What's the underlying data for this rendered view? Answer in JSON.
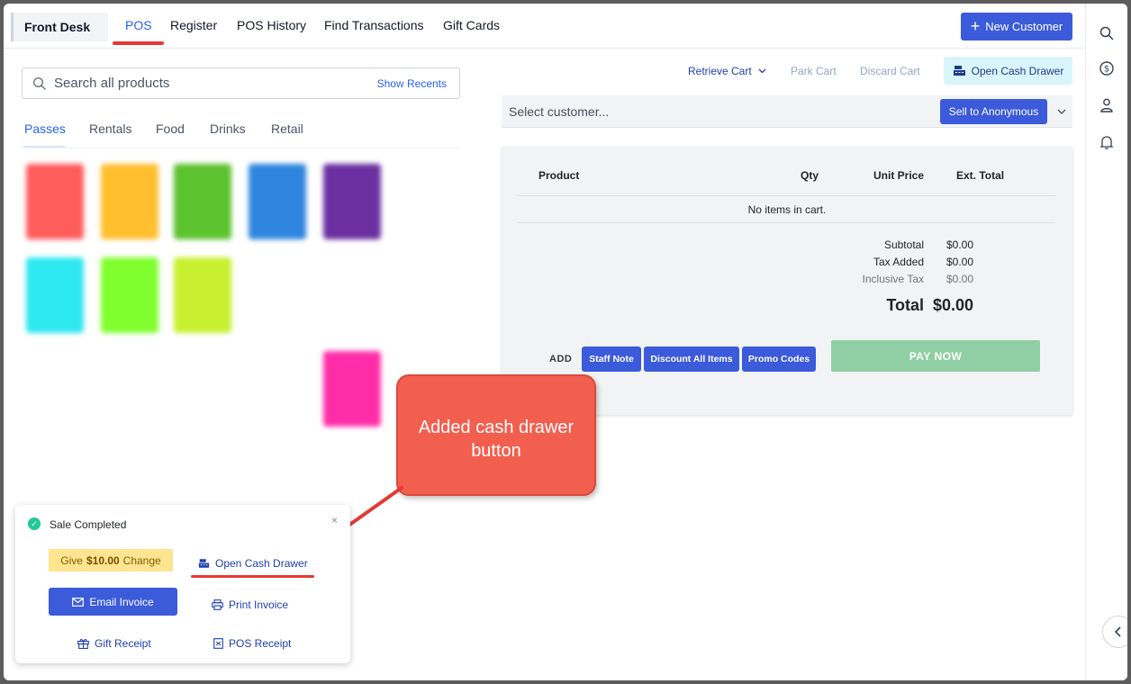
{
  "topnav": {
    "brand": "Front Desk",
    "items": [
      "POS",
      "Register",
      "POS History",
      "Find Transactions",
      "Gift Cards"
    ],
    "active": "POS",
    "new_customer_label": "New Customer"
  },
  "sidebar_right": {
    "icons": [
      "search-icon",
      "dollar-icon",
      "person-icon",
      "bell-icon",
      "chevron-left-icon"
    ]
  },
  "search": {
    "placeholder": "Search all products",
    "recents_label": "Show Recents"
  },
  "categories": {
    "tabs": [
      "Passes",
      "Rentals",
      "Food",
      "Drinks",
      "Retail"
    ],
    "active": "Passes"
  },
  "products": {
    "tile_colors": [
      "#ff5c5c",
      "#ffbf2e",
      "#5cc22e",
      "#2e86de",
      "#6b2fa0",
      "#2ee8f0",
      "#7fff2e",
      "#c8f02e",
      "#ff2ea8"
    ]
  },
  "cart": {
    "retrieve_label": "Retrieve Cart",
    "park_label": "Park Cart",
    "discard_label": "Discard Cart",
    "open_drawer_label": "Open Cash Drawer",
    "customer_placeholder": "Select customer...",
    "sell_anon_label": "Sell to Anonymous",
    "columns": [
      "Product",
      "Qty",
      "Unit Price",
      "Ext. Total"
    ],
    "empty_message": "No items in cart.",
    "subtotal_label": "Subtotal",
    "subtotal_value": "$0.00",
    "tax_label": "Tax Added",
    "tax_value": "$0.00",
    "inclusive_label": "Inclusive Tax",
    "inclusive_value": "$0.00",
    "total_label": "Total",
    "total_value": "$0.00",
    "add_label": "ADD",
    "staff_note_label": "Staff Note",
    "discount_label": "Discount All Items",
    "promo_label": "Promo Codes",
    "pay_now_label": "PAY NOW"
  },
  "callout": {
    "line1": "Added cash drawer",
    "line2": "button"
  },
  "toast": {
    "title": "Sale Completed",
    "change_prefix": "Give",
    "change_amount": "$10.00",
    "change_suffix": "Change",
    "open_drawer_label": "Open Cash Drawer",
    "email_invoice_label": "Email Invoice",
    "print_invoice_label": "Print Invoice",
    "gift_receipt_label": "Gift Receipt",
    "pos_receipt_label": "POS Receipt",
    "close_symbol": "×"
  },
  "colors": {
    "primary": "#3b5bdb",
    "link": "#2563eb",
    "accent_red": "#e53935",
    "callout": "#f25f4f",
    "pay_disabled": "#8fcfa3",
    "success": "#20c997"
  }
}
